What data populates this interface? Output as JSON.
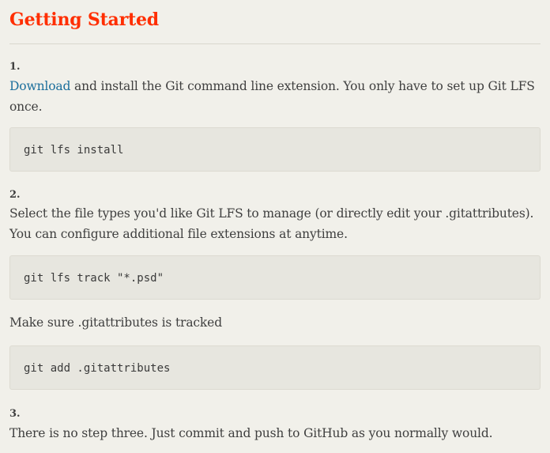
{
  "title": "Getting Started",
  "steps": [
    {
      "number": "1.",
      "link_text": "Download",
      "text": " and install the Git command line extension. You only have to set up Git LFS once.",
      "command": "git lfs install"
    },
    {
      "number": "2.",
      "text": "Select the file types you'd like Git LFS to manage (or directly edit your .gitattributes). You can configure additional file extensions at anytime.",
      "command": "git lfs track \"*.psd\"",
      "note": "Make sure .gitattributes is tracked",
      "command2": "git add .gitattributes"
    },
    {
      "number": "3.",
      "text": "There is no step three. Just commit and push to GitHub as you normally would."
    }
  ],
  "colors": {
    "background": "#f1f0ea",
    "title": "#ff2e00",
    "link": "#1c6f9c",
    "code_background": "#e7e6df"
  }
}
